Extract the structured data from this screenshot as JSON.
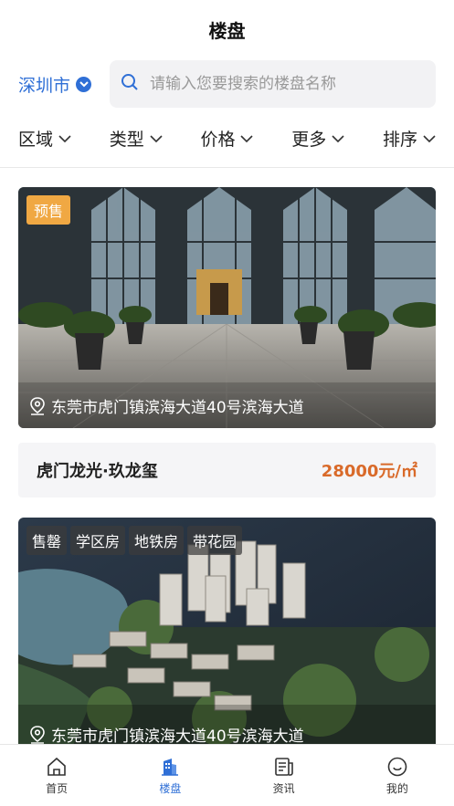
{
  "header": {
    "title": "楼盘"
  },
  "search": {
    "city": "深圳市",
    "placeholder": "请输入您要搜索的楼盘名称"
  },
  "filters": [
    "区域",
    "类型",
    "价格",
    "更多",
    "排序"
  ],
  "listings": [
    {
      "status": "预售",
      "address": "东莞市虎门镇滨海大道40号滨海大道",
      "name": "虎门龙光·玖龙玺",
      "price": "28000元/㎡"
    },
    {
      "tags": [
        "售罄",
        "学区房",
        "地铁房",
        "带花园"
      ],
      "address": "东莞市虎门镇滨海大道40号滨海大道"
    }
  ],
  "tabbar": [
    {
      "label": "首页",
      "icon": "home-icon"
    },
    {
      "label": "楼盘",
      "icon": "building-icon",
      "active": true
    },
    {
      "label": "资讯",
      "icon": "news-icon"
    },
    {
      "label": "我的",
      "icon": "profile-icon"
    }
  ],
  "colors": {
    "accent": "#2f6fd6",
    "price": "#d96a2a",
    "presale_tag": "#f0a843"
  }
}
